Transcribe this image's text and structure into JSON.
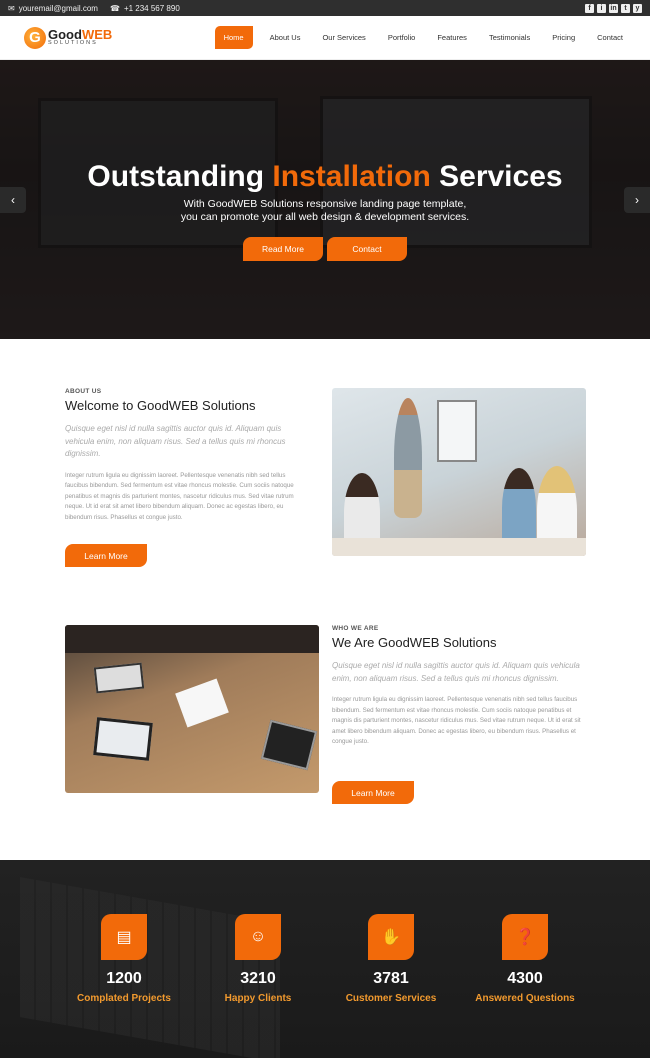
{
  "topbar": {
    "email": "youremail@gmail.com",
    "phone": "+1 234 567 890",
    "social": [
      "f",
      "i",
      "in",
      "t",
      "y"
    ]
  },
  "nav": {
    "logo_a": "Good",
    "logo_b": "WEB",
    "logo_sub": "SOLUTIONS",
    "items": [
      {
        "label": "Home"
      },
      {
        "label": "About Us"
      },
      {
        "label": "Our Services"
      },
      {
        "label": "Portfolio"
      },
      {
        "label": "Features"
      },
      {
        "label": "Testimonials"
      },
      {
        "label": "Pricing"
      },
      {
        "label": "Contact"
      }
    ]
  },
  "hero": {
    "title_a": "Outstanding",
    "title_b": "Installation",
    "title_c": "Services",
    "line1": "With GoodWEB Solutions responsive landing page template,",
    "line2": "you can promote your all web design & development services.",
    "btn1": "Read More",
    "btn2": "Contact",
    "prev": "‹",
    "next": "›"
  },
  "about": {
    "kicker": "ABOUT US",
    "title": "Welcome to GoodWEB Solutions",
    "lead": "Quisque eget nisl id nulla sagittis auctor quis id. Aliquam quis vehicula enim, non aliquam risus. Sed a tellus quis mi rhoncus dignissim.",
    "body": "Integer rutrum ligula eu dignissim laoreet. Pellentesque venenatis nibh sed tellus faucibus bibendum. Sed fermentum est vitae rhoncus molestie. Cum sociis natoque penatibus et magnis dis parturient montes, nascetur ridiculus mus. Sed vitae rutrum neque. Ut id erat sit amet libero bibendum aliquam. Donec ac egestas libero, eu bibendum risus. Phasellus et congue justo.",
    "btn": "Learn More"
  },
  "who": {
    "kicker": "WHO WE ARE",
    "title": "We Are GoodWEB Solutions",
    "lead": "Quisque eget nisl id nulla sagittis auctor quis id. Aliquam quis vehicula enim, non aliquam risus. Sed a tellus quis mi rhoncus dignissim.",
    "body": "Integer rutrum ligula eu dignissim laoreet. Pellentesque venenatis nibh sed tellus faucibus bibendum. Sed fermentum est vitae rhoncus molestie. Cum sociis natoque penatibus et magnis dis parturient montes, nascetur ridiculus mus. Sed vitae rutrum neque. Ut id erat sit amet libero bibendum aliquam. Donec ac egestas libero, eu bibendum risus. Phasellus et congue justo.",
    "btn": "Learn More"
  },
  "stats": [
    {
      "num": "1200",
      "label": "Complated Projects",
      "icon": "briefcase-icon",
      "glyph": "▤"
    },
    {
      "num": "3210",
      "label": "Happy Clients",
      "icon": "smile-icon",
      "glyph": "☺"
    },
    {
      "num": "3781",
      "label": "Customer Services",
      "icon": "headset-icon",
      "glyph": "✋"
    },
    {
      "num": "4300",
      "label": "Answered Questions",
      "icon": "chat-icon",
      "glyph": "❓"
    }
  ],
  "colors": {
    "accent": "#f26a0a",
    "accent_text": "#f29a2e",
    "dark": "#1a1a1a"
  }
}
